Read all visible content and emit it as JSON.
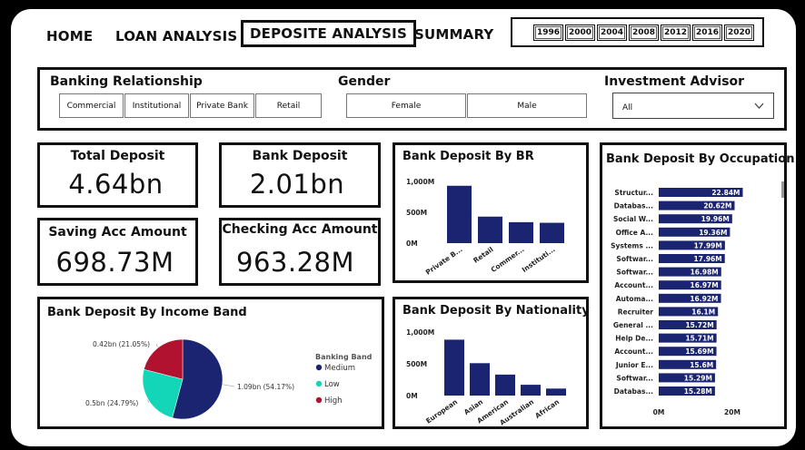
{
  "nav": {
    "home": "HOME",
    "loan": "LOAN ANALYSIS",
    "deposit": "DEPOSITE ANALYSIS",
    "summary": "SUMMARY"
  },
  "years": [
    "1996",
    "2000",
    "2004",
    "2008",
    "2012",
    "2016",
    "2020"
  ],
  "filters": {
    "banking_relationship": {
      "title": "Banking Relationship",
      "options": [
        "Commercial",
        "Institutional",
        "Private Bank",
        "Retail"
      ]
    },
    "gender": {
      "title": "Gender",
      "options": [
        "Female",
        "Male"
      ]
    },
    "investment_advisor": {
      "title": "Investment Advisor",
      "selected": "All"
    }
  },
  "kpis": {
    "total_deposit": {
      "label": "Total Deposit",
      "value": "4.64bn"
    },
    "bank_deposit": {
      "label": "Bank Deposit",
      "value": "2.01bn"
    },
    "saving": {
      "label": "Saving Acc Amount",
      "value": "698.73M"
    },
    "checking": {
      "label": "Checking Acc Amount",
      "value": "963.28M"
    }
  },
  "colors": {
    "bar": "#1b2470",
    "medium": "#1b2470",
    "low": "#13d6b8",
    "high": "#b0122f"
  },
  "chart_data": [
    {
      "id": "by_br",
      "type": "bar",
      "title": "Bank Deposit  By BR",
      "categories": [
        "Private B...",
        "Retail",
        "Commer...",
        "Instituti..."
      ],
      "values": [
        930,
        430,
        340,
        330
      ],
      "yticks": [
        "1,000M",
        "500M",
        "0M"
      ],
      "ylim": [
        0,
        1000
      ]
    },
    {
      "id": "by_nationality",
      "type": "bar",
      "title": "Bank Deposit  By Nationality",
      "categories": [
        "European",
        "Asian",
        "American",
        "Australian",
        "African"
      ],
      "values": [
        880,
        510,
        330,
        170,
        110
      ],
      "yticks": [
        "1,000M",
        "500M",
        "0M"
      ],
      "ylim": [
        0,
        1000
      ]
    },
    {
      "id": "by_income",
      "type": "pie",
      "title": "Bank Deposit  By Income Band",
      "legend_title": "Banking Band",
      "slices": [
        {
          "name": "Medium",
          "value": 1.09,
          "percent": 54.17,
          "label": "1.09bn (54.17%)"
        },
        {
          "name": "Low",
          "value": 0.5,
          "percent": 24.79,
          "label": "0.5bn (24.79%)"
        },
        {
          "name": "High",
          "value": 0.42,
          "percent": 21.05,
          "label": "0.42bn (21.05%)"
        }
      ]
    },
    {
      "id": "by_occupation",
      "type": "bar",
      "orientation": "horizontal",
      "title": "Bank Deposit  By Occupation",
      "categories": [
        "Structur...",
        "Databas...",
        "Social W...",
        "Office A...",
        "Systems ...",
        "Softwar...",
        "Softwar...",
        "Account...",
        "Automa...",
        "Recruiter",
        "General ...",
        "Help De...",
        "Account...",
        "Junior E...",
        "Softwar...",
        "Databas..."
      ],
      "values": [
        22.84,
        20.62,
        19.96,
        19.36,
        17.99,
        17.96,
        16.98,
        16.97,
        16.92,
        16.1,
        15.72,
        15.71,
        15.69,
        15.6,
        15.29,
        15.28
      ],
      "labels": [
        "22.84M",
        "20.62M",
        "19.96M",
        "19.36M",
        "17.99M",
        "17.96M",
        "16.98M",
        "16.97M",
        "16.92M",
        "16.1M",
        "15.72M",
        "15.71M",
        "15.69M",
        "15.6M",
        "15.29M",
        "15.28M"
      ],
      "xticks": [
        "0M",
        "20M"
      ],
      "xlim": [
        0,
        20
      ]
    }
  ]
}
